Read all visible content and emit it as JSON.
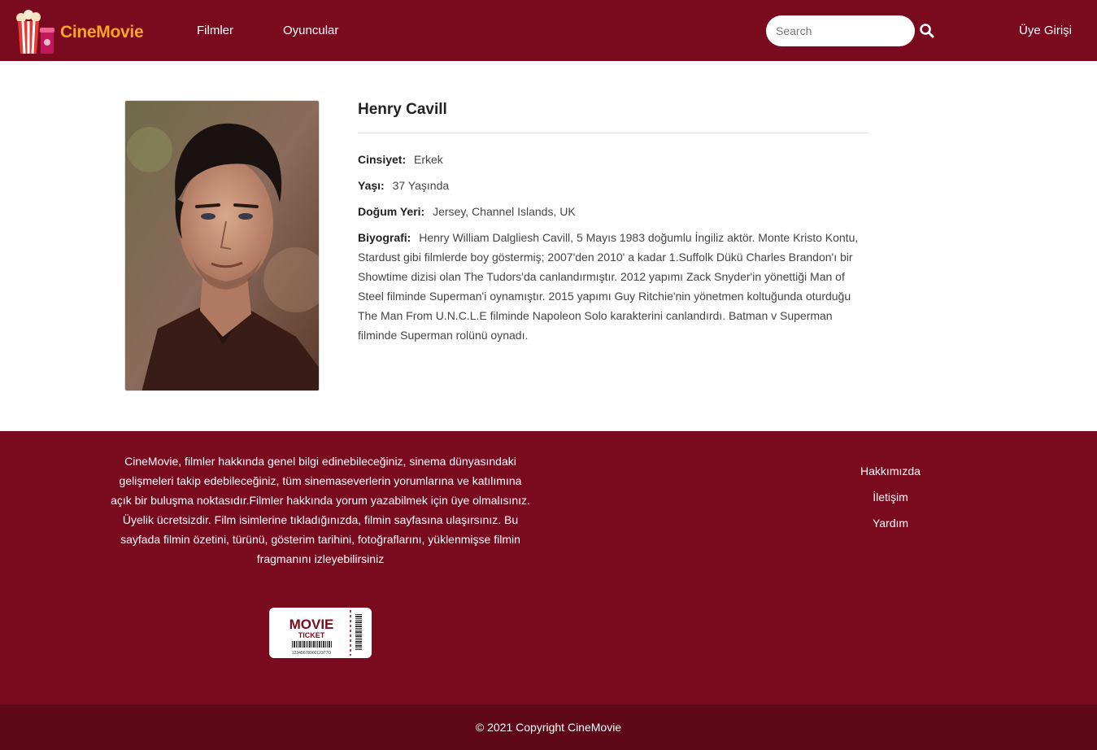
{
  "header": {
    "brand": "CineMovie",
    "nav": [
      {
        "label": "Filmler"
      },
      {
        "label": "Oyuncular"
      }
    ],
    "search": {
      "placeholder": "Search",
      "value": ""
    },
    "login_label": "Üye Girişi"
  },
  "actor": {
    "name": "Henry Cavill",
    "fields": [
      {
        "label": "Cinsiyet:",
        "value": "Erkek"
      },
      {
        "label": "Yaşı:",
        "value": "37 Yaşında"
      },
      {
        "label": "Doğum Yeri:",
        "value": "Jersey, Channel Islands, UK"
      }
    ],
    "bio_label": "Biyografi:",
    "bio": "Henry William Dalgliesh Cavill, 5 Mayıs 1983 doğumlu İngiliz aktör. Monte Kristo Kontu, Stardust gibi filmlerde boy göstermiş; 2007'den 2010' a kadar 1.Suffolk Dükü Charles Brandon'ı bir Showtime dizisi olan The Tudors'da canlandırmıştır. 2012 yapımı Zack Snyder'in yönettiği Man of Steel filminde Superman'i oynamıştır. 2015 yapımı Guy Ritchie'nin yönetmen koltuğunda oturduğu The Man From U.N.C.L.E filminde Napoleon Solo karakterini canlandırdı. Batman v Superman filminde Superman rolünü oynadı."
  },
  "footer": {
    "about": "CineMovie, filmler hakkında genel bilgi edinebileceğiniz, sinema dünyasındaki gelişmeleri takip edebileceğiniz, tüm sinemaseverlerin yorumlarına ve katılımına açık bir buluşma noktasıdır.Filmler hakkında yorum yazabilmek için üye olmalısınız. Üyelik ücretsizdir. Film isimlerine tıkladığınızda, filmin sayfasına ulaşırsınız. Bu sayfada filmin özetini, türünü, gösterim tarihini, fotoğraflarını, yüklenmişse filmin fragmanını izleyebilirsiniz",
    "links": [
      {
        "label": "Hakkımızda"
      },
      {
        "label": "İletişim"
      },
      {
        "label": "Yardım"
      }
    ],
    "ticket": {
      "title": "MOVIE",
      "subtitle": "TICKET",
      "barcode_number": "1234567890012377O"
    },
    "copyright": "© 2021 Copyright CineMovie"
  },
  "colors": {
    "primary": "#7a0a1e",
    "dark": "#5f0818",
    "brand_text": "#f6a623"
  }
}
